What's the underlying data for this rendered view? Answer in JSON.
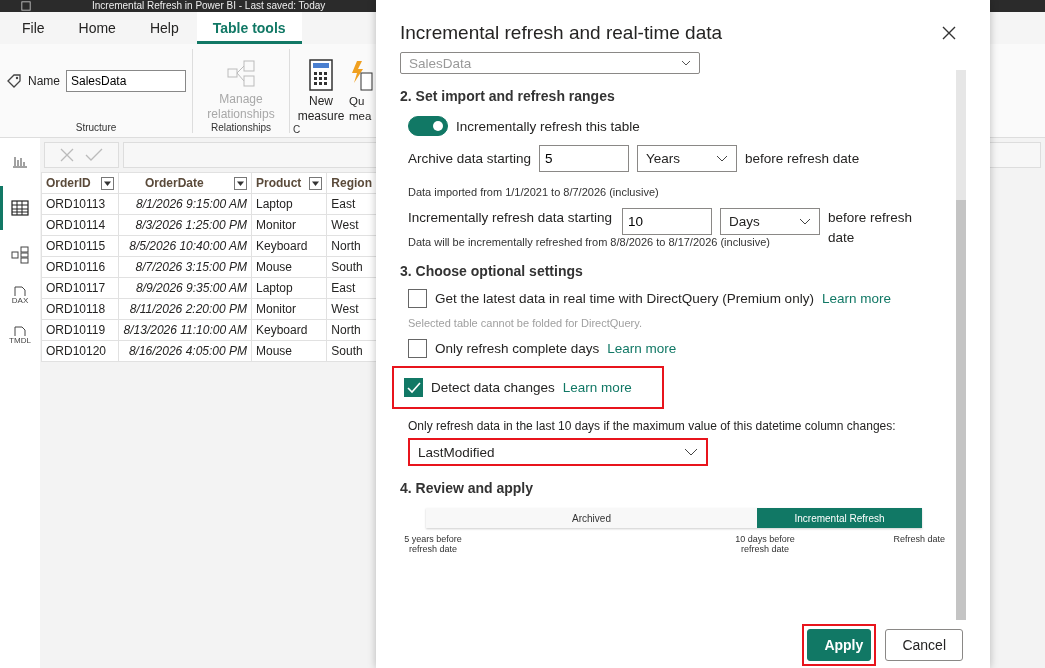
{
  "title_bar": {
    "text": "Incremental Refresh in Power BI - Last saved: Today"
  },
  "ribbon": {
    "tabs": [
      {
        "label": "File",
        "selected": false
      },
      {
        "label": "Home",
        "selected": false
      },
      {
        "label": "Help",
        "selected": false
      },
      {
        "label": "Table tools",
        "selected": true
      }
    ],
    "name_field": {
      "label": "Name",
      "value": "SalesData"
    },
    "groups": [
      {
        "kind": "structure",
        "label": "Structure"
      },
      {
        "kind": "relationships",
        "label": "Relationships",
        "button": "Manage relationships",
        "disabled": true
      },
      {
        "kind": "calculations",
        "label": "C",
        "buttons": [
          "New measure",
          "Qu mea"
        ]
      }
    ]
  },
  "rail": [
    {
      "kind": "report",
      "selected": false
    },
    {
      "kind": "table",
      "selected": true
    },
    {
      "kind": "model",
      "selected": false
    },
    {
      "kind": "file",
      "label": "DAX",
      "selected": false
    },
    {
      "kind": "file",
      "label": "TMDL",
      "selected": false
    }
  ],
  "table": {
    "columns": [
      "OrderID",
      "OrderDate",
      "Product",
      "Region"
    ],
    "rows": [
      [
        "ORD10113",
        "8/1/2026 9:15:00 AM",
        "Laptop",
        "East"
      ],
      [
        "ORD10114",
        "8/3/2026 1:25:00 PM",
        "Monitor",
        "West"
      ],
      [
        "ORD10115",
        "8/5/2026 10:40:00 AM",
        "Keyboard",
        "North"
      ],
      [
        "ORD10116",
        "8/7/2026 3:15:00 PM",
        "Mouse",
        "South"
      ],
      [
        "ORD10117",
        "8/9/2026 9:35:00 AM",
        "Laptop",
        "East"
      ],
      [
        "ORD10118",
        "8/11/2026 2:20:00 PM",
        "Monitor",
        "West"
      ],
      [
        "ORD10119",
        "8/13/2026 11:10:00 AM",
        "Keyboard",
        "North"
      ],
      [
        "ORD10120",
        "8/16/2026 4:05:00 PM",
        "Mouse",
        "South"
      ]
    ]
  },
  "dialog": {
    "title": "Incremental refresh and real-time data",
    "table_select": {
      "value": "SalesData"
    },
    "section_2": "2. Set import and refresh ranges",
    "toggle": {
      "label": "Incrementally refresh this table",
      "on": true
    },
    "archive": {
      "label": "Archive data starting",
      "value": "5",
      "unit": "Years",
      "suffix": "before refresh date",
      "note": "Data imported from 1/1/2021 to 8/7/2026 (inclusive)"
    },
    "incremental": {
      "label": "Incrementally refresh data starting",
      "value": "10",
      "unit": "Days",
      "suffix": "before refresh date",
      "note": "Data will be incrementally refreshed from 8/8/2026 to 8/17/2026 (inclusive)"
    },
    "section_3": "3. Choose optional settings",
    "options": [
      {
        "label": "Get the latest data in real time with DirectQuery (Premium only)",
        "link": "Learn more",
        "checked": false,
        "highlighted": false,
        "note": "Selected table cannot be folded for DirectQuery."
      },
      {
        "label": "Only refresh complete days",
        "link": "Learn more",
        "checked": false,
        "highlighted": false
      },
      {
        "label": "Detect data changes",
        "link": "Learn more",
        "checked": true,
        "highlighted": true
      }
    ],
    "column_select": {
      "label": "Only refresh data in the last 10 days if the maximum value of this datetime column changes:",
      "value": "LastModified",
      "highlighted": true
    },
    "section_4": "4. Review and apply",
    "timeline": {
      "segments": [
        {
          "label": "Archived",
          "kind": "archived"
        },
        {
          "label": "Incremental Refresh",
          "kind": "incremental"
        }
      ],
      "marks": [
        "5 years before refresh date",
        "10 days before refresh date",
        "Refresh date"
      ]
    },
    "buttons": [
      {
        "label": "Apply",
        "kind": "primary",
        "highlighted": true
      },
      {
        "label": "Cancel",
        "kind": "secondary",
        "highlighted": false
      }
    ]
  }
}
